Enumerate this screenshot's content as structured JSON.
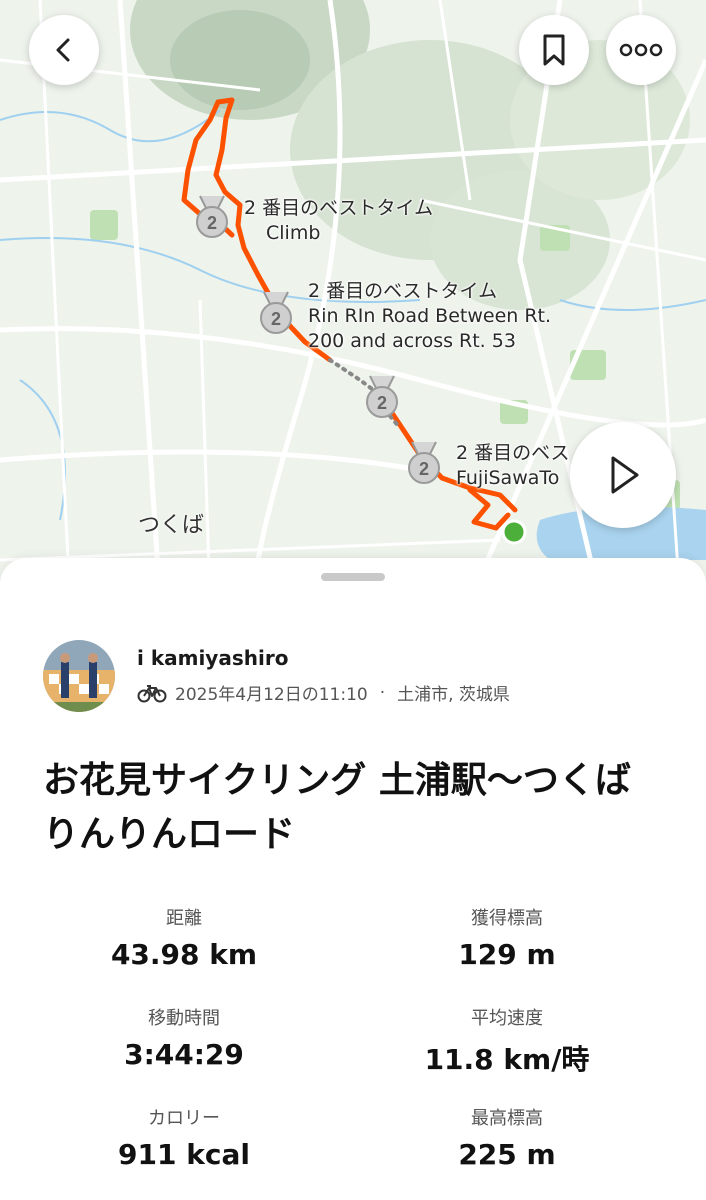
{
  "map": {
    "segments": [
      {
        "rank": "2",
        "line1": "2 番目のベストタイム",
        "line2": "Climb",
        "line3": ""
      },
      {
        "rank": "2",
        "line1": "2 番目のベストタイム",
        "line2": "Rin RIn Road Between Rt.",
        "line3": "200 and across Rt. 53"
      },
      {
        "rank": "2",
        "line1": "",
        "line2": "",
        "line3": ""
      },
      {
        "rank": "2",
        "line1": "2 番目のベス",
        "line2": "FujiSawaTo",
        "line3": ""
      }
    ],
    "town": "つくば",
    "route_color": "#fc5200",
    "end_marker_color": "#4caf3a"
  },
  "nav": {
    "back_icon": "chevron-left-icon",
    "bookmark_icon": "bookmark-icon",
    "more_icon": "more-dots-icon",
    "play_icon": "play-icon"
  },
  "activity": {
    "athlete": "i kamiyashiro",
    "sport_icon": "bike-icon",
    "datetime": "2025年4月12日の11:10",
    "separator": "·",
    "location": "土浦市, 茨城県",
    "title": "お花見サイクリング 土浦駅〜つくばりんりんロード"
  },
  "stats": [
    {
      "label": "距離",
      "value": "43.98 km"
    },
    {
      "label": "獲得標高",
      "value": "129 m"
    },
    {
      "label": "移動時間",
      "value": "3:44:29"
    },
    {
      "label": "平均速度",
      "value": "11.8 km/時"
    },
    {
      "label": "カロリー",
      "value": "911 kcal"
    },
    {
      "label": "最高標高",
      "value": "225 m"
    }
  ]
}
